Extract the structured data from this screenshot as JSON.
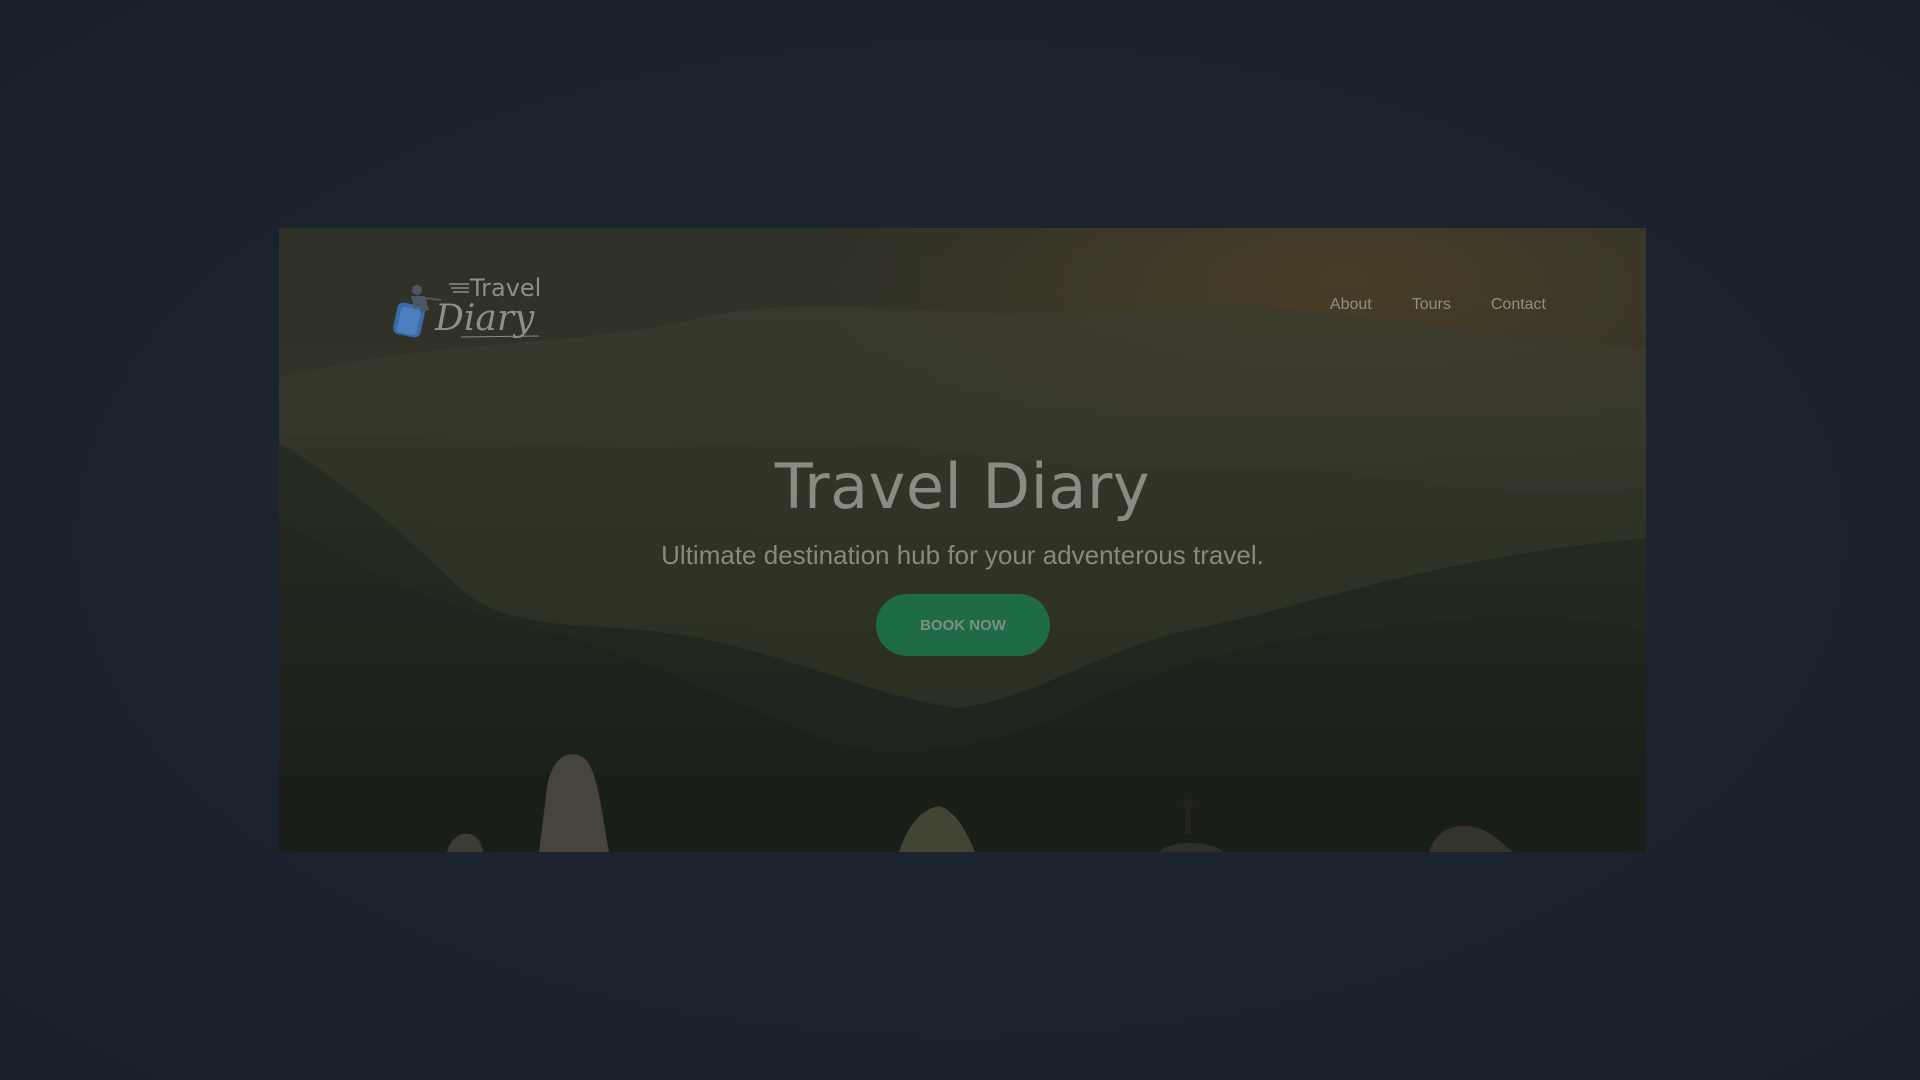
{
  "brand": {
    "logo_line1": "Travel",
    "logo_line2": "Diary"
  },
  "nav": {
    "items": [
      {
        "label": "About"
      },
      {
        "label": "Tours"
      },
      {
        "label": "Contact"
      }
    ]
  },
  "hero": {
    "title": "Travel Diary",
    "subtitle": "Ultimate destination hub for your adventerous travel.",
    "cta_label": "BOOK NOW"
  },
  "colors": {
    "page_background": "#1c2430",
    "cta_button": "#1f6b45",
    "logo_accent": "#3b6aa8"
  },
  "icons": {
    "logo_icon": "traveler-luggage-icon"
  }
}
